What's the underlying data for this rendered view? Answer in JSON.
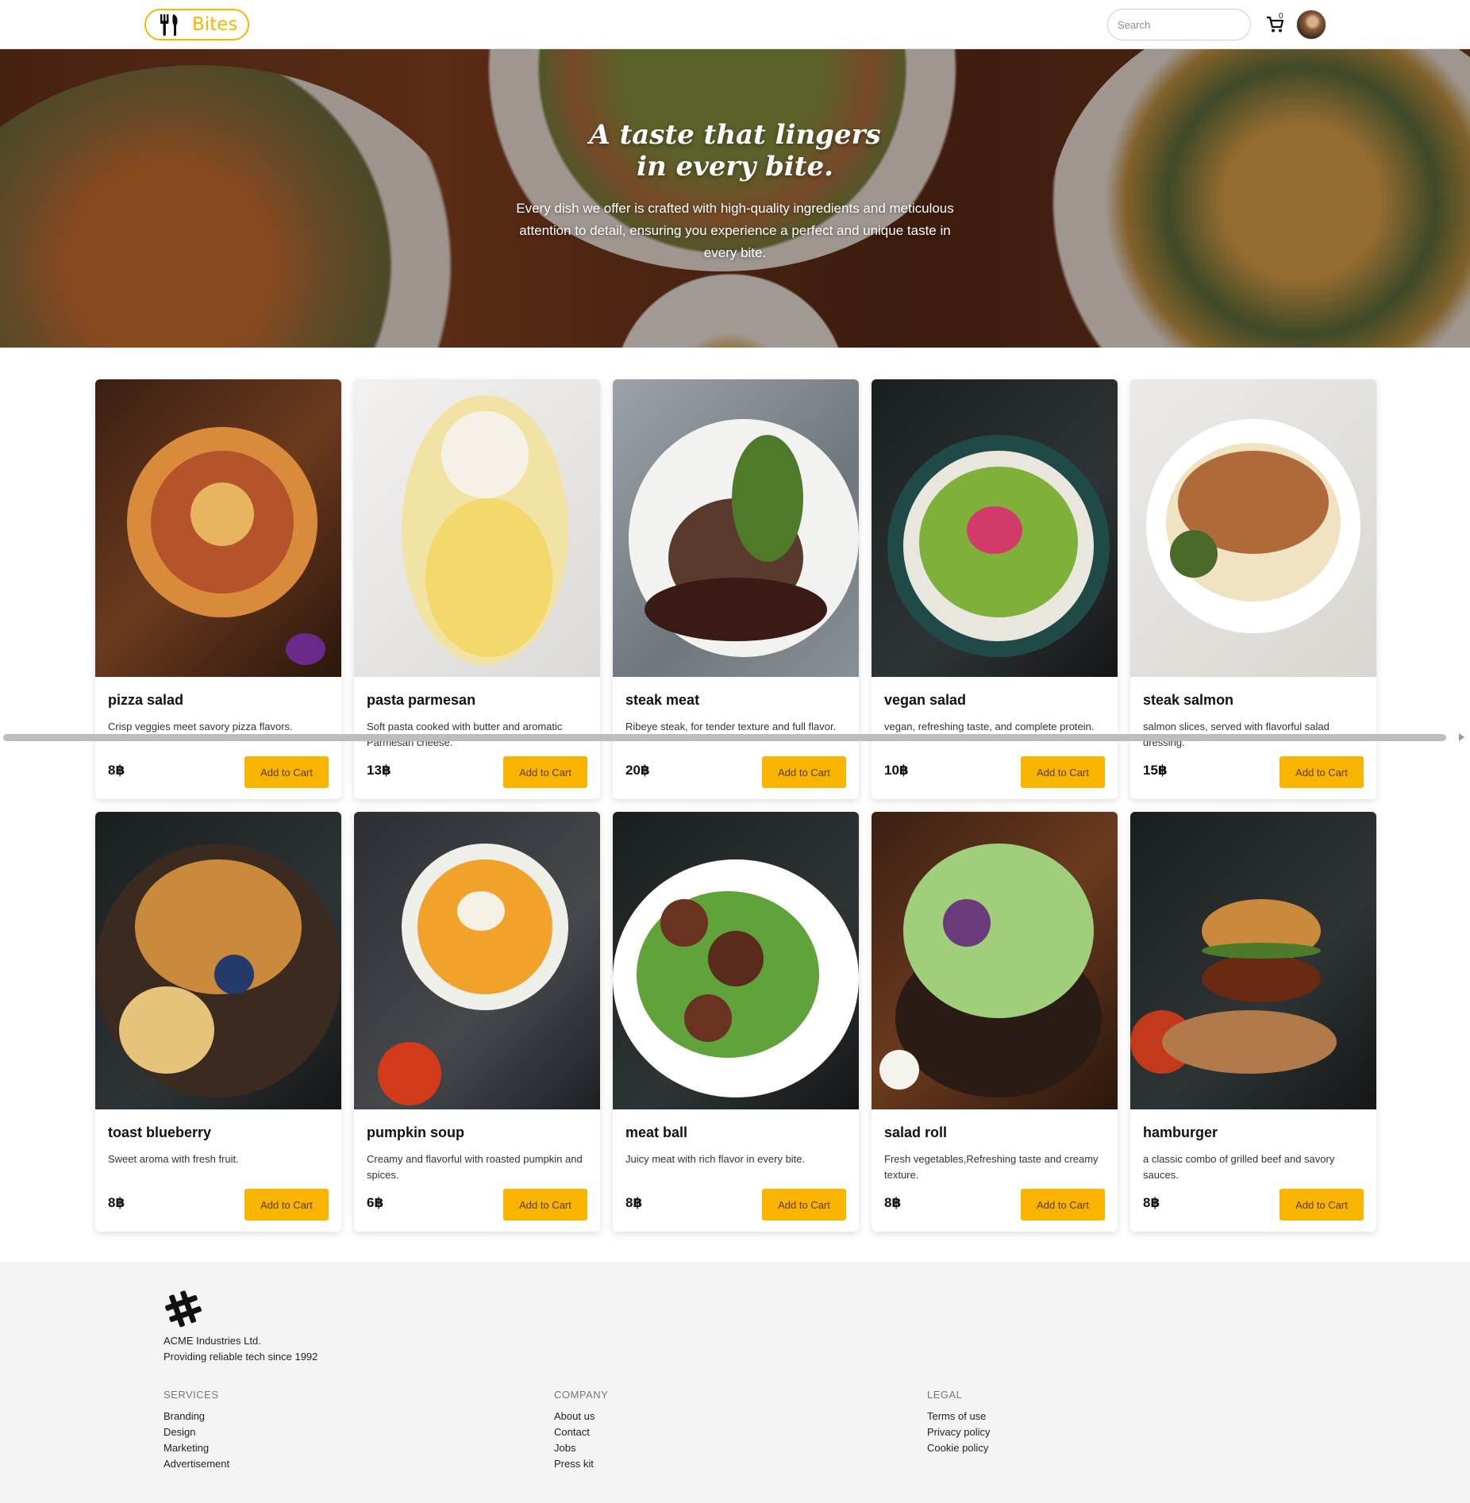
{
  "navbar": {
    "brand": "Bites",
    "search_placeholder": "Search",
    "cart_count": "0"
  },
  "hero": {
    "title_line1": "A taste that lingers",
    "title_line2": "in every bite.",
    "text": "Every dish we offer is crafted with high-quality ingredients and meticulous attention to detail, ensuring you experience a perfect and unique taste in every bite."
  },
  "add_label": "Add to Cart",
  "products": [
    {
      "name": "pizza salad",
      "desc": "Crisp veggies meet savory pizza flavors.",
      "price": "8฿",
      "image": "pizza"
    },
    {
      "name": "pasta parmesan",
      "desc": "Soft pasta cooked with butter and aromatic Parmesan cheese.",
      "price": "13฿",
      "image": "pasta"
    },
    {
      "name": "steak meat",
      "desc": "Ribeye steak, for tender texture and full flavor.",
      "price": "20฿",
      "image": "steak"
    },
    {
      "name": "vegan salad",
      "desc": "vegan, refreshing taste, and complete protein.",
      "price": "10฿",
      "image": "vegan"
    },
    {
      "name": "steak salmon",
      "desc": "salmon slices, served with flavorful salad dressing.",
      "price": "15฿",
      "image": "salmon"
    },
    {
      "name": "toast blueberry",
      "desc": "Sweet aroma with fresh fruit.",
      "price": "8฿",
      "image": "toast"
    },
    {
      "name": "pumpkin soup",
      "desc": "Creamy and flavorful with roasted pumpkin and spices.",
      "price": "6฿",
      "image": "soup"
    },
    {
      "name": "meat ball",
      "desc": "Juicy meat with rich flavor in every bite.",
      "price": "8฿",
      "image": "meatball"
    },
    {
      "name": "salad roll",
      "desc": "Fresh vegetables,Refreshing taste and creamy texture.",
      "price": "8฿",
      "image": "roll"
    },
    {
      "name": "hamburger",
      "desc": "a classic combo of grilled beef and savory sauces.",
      "price": "8฿",
      "image": "burger"
    }
  ],
  "footer": {
    "company_name": "ACME Industries Ltd.",
    "company_tagline": "Providing reliable tech since 1992",
    "services": {
      "title": "SERVICES",
      "links": [
        "Branding",
        "Design",
        "Marketing",
        "Advertisement"
      ]
    },
    "company": {
      "title": "COMPANY",
      "links": [
        "About us",
        "Contact",
        "Jobs",
        "Press kit"
      ]
    },
    "legal": {
      "title": "LEGAL",
      "links": [
        "Terms of use",
        "Privacy policy",
        "Cookie policy"
      ]
    }
  },
  "colors": {
    "accent": "#f9b400",
    "brand": "#f5b800",
    "footer_bg": "#f4f4f4"
  }
}
